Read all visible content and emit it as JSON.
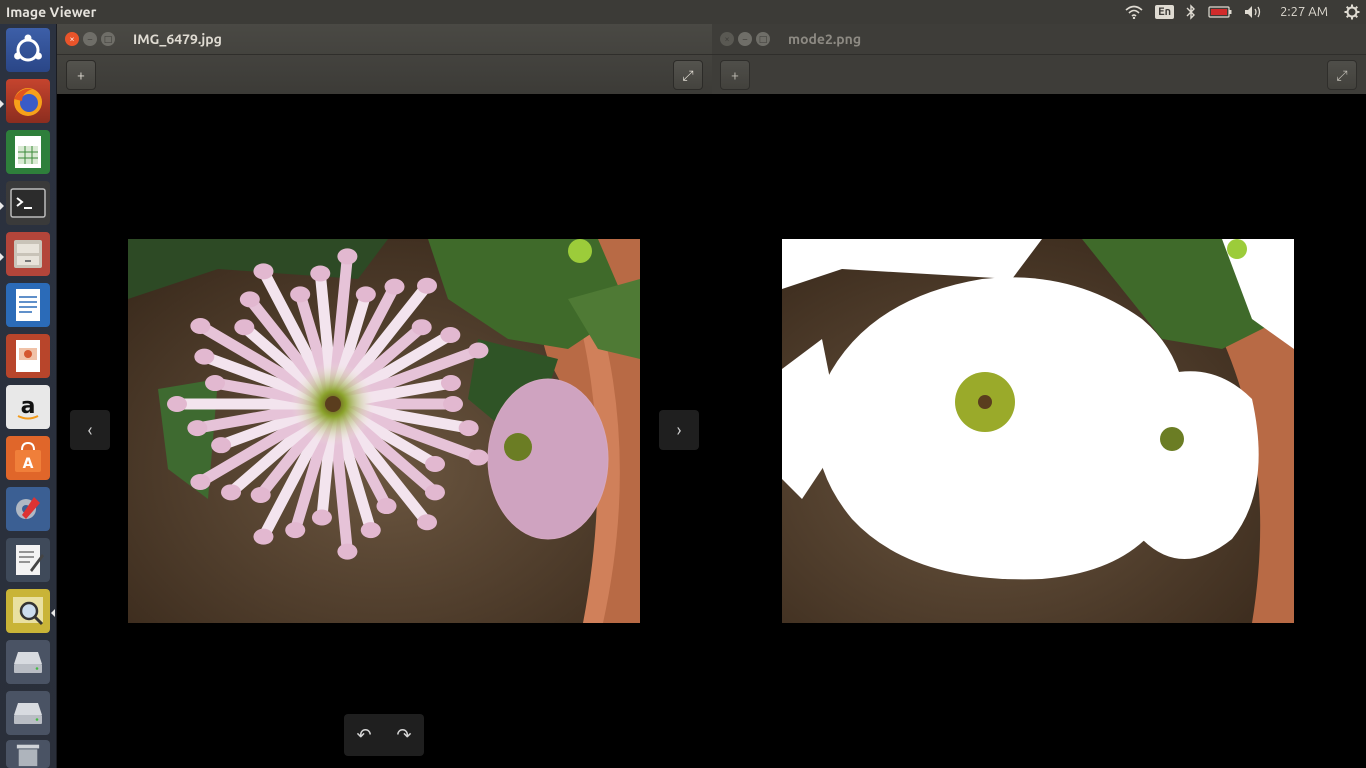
{
  "app_title": "Image Viewer",
  "panel": {
    "keyboard_layout": "En",
    "clock": "2:27 AM",
    "icons": [
      "wifi-icon",
      "bluetooth-icon",
      "battery-icon",
      "volume-icon",
      "settings-gear-icon"
    ]
  },
  "launcher": {
    "items": [
      {
        "name": "ubuntu-dash",
        "icon": "ubuntu-logo-icon"
      },
      {
        "name": "firefox",
        "icon": "firefox-icon"
      },
      {
        "name": "libreoffice-calc",
        "icon": "spreadsheet-icon"
      },
      {
        "name": "terminal",
        "icon": "terminal-icon"
      },
      {
        "name": "files",
        "icon": "file-cabinet-icon"
      },
      {
        "name": "libreoffice-writer",
        "icon": "document-icon"
      },
      {
        "name": "libreoffice-impress",
        "icon": "presentation-icon"
      },
      {
        "name": "amazon",
        "icon": "amazon-icon"
      },
      {
        "name": "software-center",
        "icon": "shopping-bag-icon"
      },
      {
        "name": "system-settings",
        "icon": "wrench-gear-icon"
      },
      {
        "name": "text-editor",
        "icon": "text-editor-icon"
      },
      {
        "name": "image-viewer",
        "icon": "image-viewer-icon"
      },
      {
        "name": "drive-1",
        "icon": "drive-icon"
      },
      {
        "name": "drive-2",
        "icon": "drive-icon"
      },
      {
        "name": "trash",
        "icon": "trash-icon"
      }
    ]
  },
  "windows": [
    {
      "title": "IMG_6479.jpg",
      "active": true
    },
    {
      "title": "mode2.png",
      "active": false
    }
  ],
  "controls": {
    "prev": "‹",
    "next": "›",
    "rotate_left": "↶",
    "rotate_right": "↷",
    "add": "+",
    "fullscreen": "⤢",
    "close": "×",
    "minimize": "–",
    "maximize": "□"
  }
}
